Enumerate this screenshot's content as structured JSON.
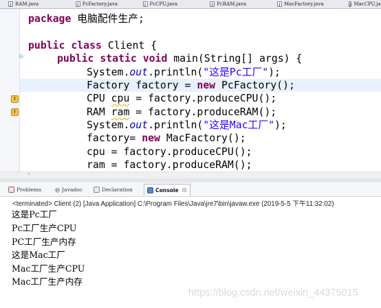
{
  "tabs": [
    "RAM.java",
    "PcFactory.java",
    "PcCPU.java",
    "PcRAM.java",
    "MacFactory.java",
    "MacCPU.java"
  ],
  "code": {
    "pkg_kw": "package",
    "pkg_name": " 电脑配件生产;",
    "l3_kw": "public class",
    "l3_rest": " Client {",
    "l4_kw": "public static void",
    "l4_rest": " main(String[] args) {",
    "l5_a": "System.",
    "l5_fld": "out",
    "l5_b": ".println(",
    "l5_str": "\"这是Pc工厂\"",
    "l5_c": ");",
    "l6_a": "Factory factory = ",
    "l6_kw": "new",
    "l6_b": " PcFactory();",
    "l7_a": "CPU ",
    "l7_var": "cpu",
    "l7_b": " = factory.produceCPU();",
    "l8_a": "RAM ",
    "l8_var": "ram",
    "l8_b": " = factory.produceRAM();",
    "l9_a": "System.",
    "l9_fld": "out",
    "l9_b": ".println(",
    "l9_str": "\"这是Mac工厂\"",
    "l9_c": ");",
    "l10_a": "factory= ",
    "l10_kw": "new",
    "l10_b": " MacFactory();",
    "l11": "cpu = factory.produceCPU();",
    "l12": "ram = factory.produceRAM();"
  },
  "console": {
    "tabs": {
      "problems": "Problems",
      "javadoc": "@ Javadoc",
      "declaration": "Declaration",
      "console": "Console"
    },
    "terminated": "<terminated> Client (2) [Java Application] C:\\Program Files\\Java\\jre7\\bin\\javaw.exe (2019-5-5 下午11:32:02)",
    "output": [
      "这是Pc工厂",
      "Pc工厂生产CPU",
      "PC工厂生产内存",
      "这是Mac工厂",
      "Mac工厂生产CPU",
      "Mac工厂生产内存"
    ]
  },
  "watermark": "https://blog.csdn.net/weixin_44375015",
  "colors": {
    "keyword": "#7f0055",
    "string": "#2a00ff",
    "field": "#0000c0",
    "highlight": "#e8f2fe"
  }
}
